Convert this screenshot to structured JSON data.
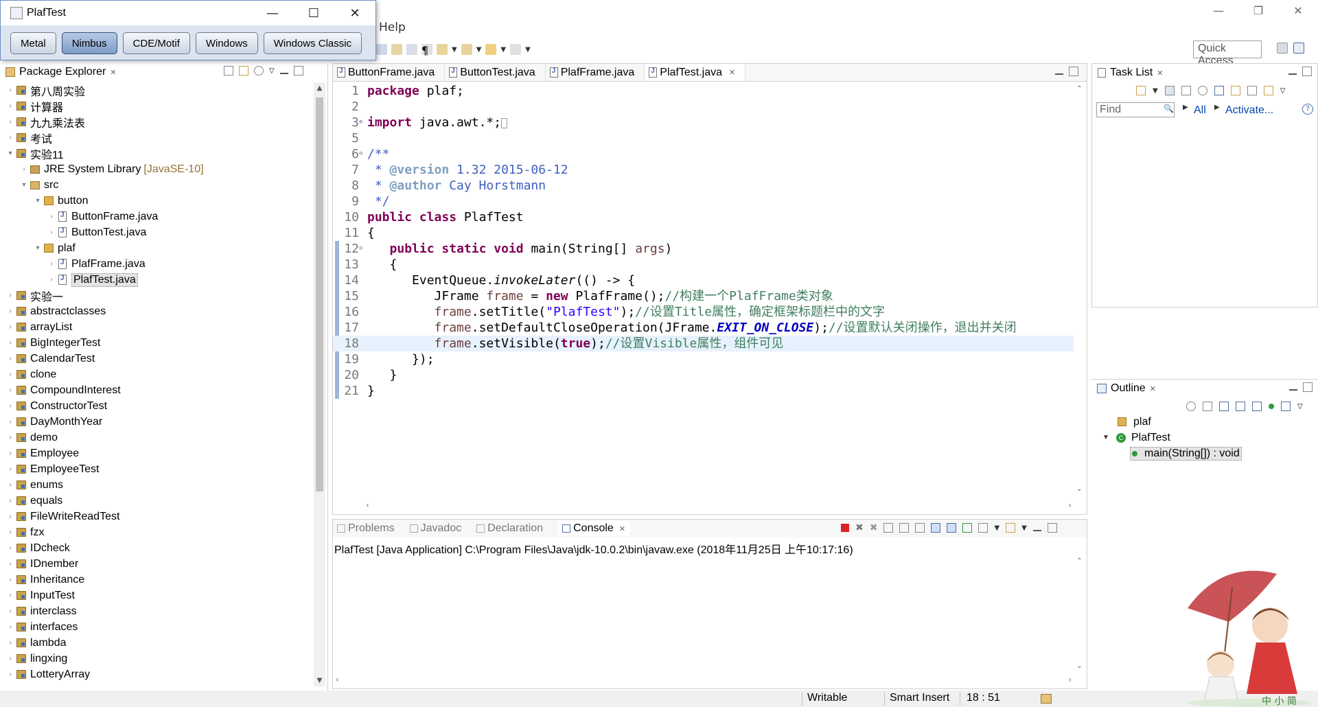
{
  "plaf_window": {
    "title": "PlafTest",
    "buttons": [
      "Metal",
      "Nimbus",
      "CDE/Motif",
      "Windows",
      "Windows Classic"
    ],
    "selected_button": "Nimbus"
  },
  "ide": {
    "menu_help": "Help",
    "quick_access": "Quick Access"
  },
  "package_explorer": {
    "title": "Package Explorer",
    "items": [
      {
        "label": "第八周实验",
        "indent": 0,
        "twisty": "›",
        "icon": "project"
      },
      {
        "label": "计算器",
        "indent": 0,
        "twisty": "›",
        "icon": "project"
      },
      {
        "label": "九九乘法表",
        "indent": 0,
        "twisty": "›",
        "icon": "project"
      },
      {
        "label": "考试",
        "indent": 0,
        "twisty": "›",
        "icon": "project"
      },
      {
        "label": "实验11",
        "indent": 0,
        "twisty": "⌄",
        "icon": "project"
      },
      {
        "label": "JRE System Library",
        "extra": "[JavaSE-10]",
        "indent": 1,
        "twisty": "›",
        "icon": "jre"
      },
      {
        "label": "src",
        "indent": 1,
        "twisty": "⌄",
        "icon": "src"
      },
      {
        "label": "button",
        "indent": 2,
        "twisty": "⌄",
        "icon": "package"
      },
      {
        "label": "ButtonFrame.java",
        "indent": 3,
        "twisty": "›",
        "icon": "java"
      },
      {
        "label": "ButtonTest.java",
        "indent": 3,
        "twisty": "›",
        "icon": "java"
      },
      {
        "label": "plaf",
        "indent": 2,
        "twisty": "⌄",
        "icon": "package"
      },
      {
        "label": "PlafFrame.java",
        "indent": 3,
        "twisty": "›",
        "icon": "java"
      },
      {
        "label": "PlafTest.java",
        "indent": 3,
        "twisty": "›",
        "icon": "java",
        "selected": true
      },
      {
        "label": "实验一",
        "indent": 0,
        "twisty": "›",
        "icon": "project"
      },
      {
        "label": "abstractclasses",
        "indent": 0,
        "twisty": "›",
        "icon": "project"
      },
      {
        "label": "arrayList",
        "indent": 0,
        "twisty": "›",
        "icon": "project"
      },
      {
        "label": "BigIntegerTest",
        "indent": 0,
        "twisty": "›",
        "icon": "project"
      },
      {
        "label": "CalendarTest",
        "indent": 0,
        "twisty": "›",
        "icon": "project"
      },
      {
        "label": "clone",
        "indent": 0,
        "twisty": "›",
        "icon": "project"
      },
      {
        "label": "CompoundInterest",
        "indent": 0,
        "twisty": "›",
        "icon": "project"
      },
      {
        "label": "ConstructorTest",
        "indent": 0,
        "twisty": "›",
        "icon": "project"
      },
      {
        "label": "DayMonthYear",
        "indent": 0,
        "twisty": "›",
        "icon": "project"
      },
      {
        "label": "demo",
        "indent": 0,
        "twisty": "›",
        "icon": "project"
      },
      {
        "label": "Employee",
        "indent": 0,
        "twisty": "›",
        "icon": "project"
      },
      {
        "label": "EmployeeTest",
        "indent": 0,
        "twisty": "›",
        "icon": "project"
      },
      {
        "label": "enums",
        "indent": 0,
        "twisty": "›",
        "icon": "project"
      },
      {
        "label": "equals",
        "indent": 0,
        "twisty": "›",
        "icon": "project"
      },
      {
        "label": "FileWriteReadTest",
        "indent": 0,
        "twisty": "›",
        "icon": "project"
      },
      {
        "label": "fzx",
        "indent": 0,
        "twisty": "›",
        "icon": "project"
      },
      {
        "label": "IDcheck",
        "indent": 0,
        "twisty": "›",
        "icon": "project"
      },
      {
        "label": "IDnember",
        "indent": 0,
        "twisty": "›",
        "icon": "project"
      },
      {
        "label": "Inheritance",
        "indent": 0,
        "twisty": "›",
        "icon": "project"
      },
      {
        "label": "InputTest",
        "indent": 0,
        "twisty": "›",
        "icon": "project"
      },
      {
        "label": "interclass",
        "indent": 0,
        "twisty": "›",
        "icon": "project"
      },
      {
        "label": "interfaces",
        "indent": 0,
        "twisty": "›",
        "icon": "project"
      },
      {
        "label": "lambda",
        "indent": 0,
        "twisty": "›",
        "icon": "project"
      },
      {
        "label": "lingxing",
        "indent": 0,
        "twisty": "›",
        "icon": "project"
      },
      {
        "label": "LotteryArray",
        "indent": 0,
        "twisty": "›",
        "icon": "project"
      }
    ]
  },
  "editor": {
    "tabs": [
      {
        "label": "ButtonFrame.java",
        "active": false
      },
      {
        "label": "ButtonTest.java",
        "active": false
      },
      {
        "label": "PlafFrame.java",
        "active": false
      },
      {
        "label": "PlafTest.java",
        "active": true
      }
    ],
    "current_line": 18,
    "lines": [
      {
        "n": "1",
        "fold": "",
        "html": "<span class=\"kw\">package</span> plaf;"
      },
      {
        "n": "2",
        "fold": "",
        "html": ""
      },
      {
        "n": "3",
        "fold": "⊕",
        "html": "<span class=\"kw\">import</span> java.awt.*;<span style=\"display:inline-block;width:9px;height:15px;border:1px solid #999;vertical-align:middle\"></span>"
      },
      {
        "n": "5",
        "fold": "",
        "html": ""
      },
      {
        "n": "6",
        "fold": "⊖",
        "html": "<span class=\"jd\">/**</span>"
      },
      {
        "n": "7",
        "fold": "",
        "html": "<span class=\"jd\"> * </span><span class=\"jdtag\">@version</span><span class=\"jd\"> 1.32 2015-06-12</span>"
      },
      {
        "n": "8",
        "fold": "",
        "html": "<span class=\"jd\"> * </span><span class=\"jdtag\">@author</span><span class=\"jd\"> Cay Horstmann</span>"
      },
      {
        "n": "9",
        "fold": "",
        "html": "<span class=\"jd\"> */</span>"
      },
      {
        "n": "10",
        "fold": "",
        "html": "<span class=\"kw\">public</span> <span class=\"kw\">class</span> PlafTest"
      },
      {
        "n": "11",
        "fold": "",
        "html": "{"
      },
      {
        "n": "12",
        "fold": "⊖",
        "html": "   <span class=\"kw\">public</span> <span class=\"kw\">static</span> <span class=\"kw\">void</span> main(String[] <span class=\"loc\">args</span>)"
      },
      {
        "n": "13",
        "fold": "",
        "html": "   {"
      },
      {
        "n": "14",
        "fold": "",
        "html": "      EventQueue.<span class=\"it\">invokeLater</span>(() -> {"
      },
      {
        "n": "15",
        "fold": "",
        "html": "         JFrame <span class=\"loc\">frame</span> = <span class=\"kw\">new</span> PlafFrame();<span class=\"cm\">//构建一个PlafFrame类对象</span>"
      },
      {
        "n": "16",
        "fold": "",
        "html": "         <span class=\"loc\">frame</span>.setTitle(<span class=\"str\">\"PlafTest\"</span>);<span class=\"cm\">//设置Title属性，确定框架标题栏中的文字</span>"
      },
      {
        "n": "17",
        "fold": "",
        "html": "         <span class=\"loc\">frame</span>.setDefaultCloseOperation(JFrame.<span class=\"fld-it\">EXIT_ON_CLOSE</span>);<span class=\"cm\">//设置默认关闭操作，退出并关闭</span>"
      },
      {
        "n": "18",
        "fold": "",
        "html": "         <span class=\"loc\">frame</span>.setVisible(<span class=\"kw\">true</span>);<span class=\"cm\">//设置Visible属性，组件可见</span>"
      },
      {
        "n": "19",
        "fold": "",
        "html": "      });"
      },
      {
        "n": "20",
        "fold": "",
        "html": "   }"
      },
      {
        "n": "21",
        "fold": "",
        "html": "}"
      }
    ]
  },
  "task_list": {
    "title": "Task List",
    "find_placeholder": "Find",
    "all_label": "All",
    "activate_label": "Activate..."
  },
  "outline": {
    "title": "Outline",
    "items": [
      {
        "label": "plaf",
        "indent": 0
      },
      {
        "label": "PlafTest",
        "indent": 0,
        "twisty": "⌄"
      },
      {
        "label": "main(String[]) : void",
        "indent": 1,
        "selected": true
      }
    ]
  },
  "console": {
    "tabs": [
      {
        "label": "Problems",
        "active": false
      },
      {
        "label": "Javadoc",
        "active": false
      },
      {
        "label": "Declaration",
        "active": false
      },
      {
        "label": "Console",
        "active": true
      }
    ],
    "process_line": "PlafTest [Java Application] C:\\Program Files\\Java\\jdk-10.0.2\\bin\\javaw.exe (2018年11月25日 上午10:17:16)"
  },
  "status": {
    "writable": "Writable",
    "insert_mode": "Smart Insert",
    "position": "18 : 51"
  },
  "deco_text": "中 小 简"
}
